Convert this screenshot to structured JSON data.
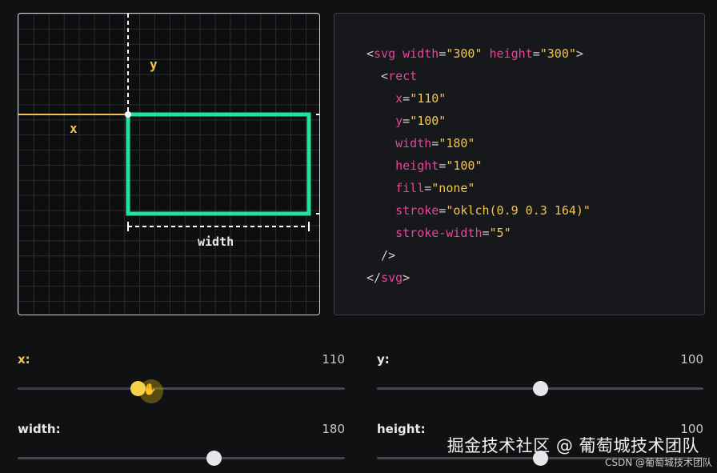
{
  "diagram": {
    "labels": {
      "x": "x",
      "y": "y",
      "width": "width"
    },
    "colors": {
      "rect_stroke": "#1ee59b",
      "x_line": "#f4c44a",
      "dash": "#ffffff"
    }
  },
  "code": {
    "lines": [
      {
        "parts": [
          [
            "punct",
            "<"
          ],
          [
            "tag",
            "svg "
          ],
          [
            "attr",
            "width"
          ],
          [
            "punct",
            "="
          ],
          [
            "val",
            "\"300\""
          ],
          [
            "punct",
            " "
          ],
          [
            "attr",
            "height"
          ],
          [
            "punct",
            "="
          ],
          [
            "val",
            "\"300\""
          ],
          [
            "punct",
            ">"
          ]
        ]
      },
      {
        "parts": [
          [
            "punct",
            "  <"
          ],
          [
            "tag",
            "rect"
          ]
        ]
      },
      {
        "parts": [
          [
            "punct",
            "    "
          ],
          [
            "attr",
            "x"
          ],
          [
            "punct",
            "="
          ],
          [
            "val",
            "\"110\""
          ]
        ]
      },
      {
        "parts": [
          [
            "punct",
            "    "
          ],
          [
            "attr",
            "y"
          ],
          [
            "punct",
            "="
          ],
          [
            "val",
            "\"100\""
          ]
        ]
      },
      {
        "parts": [
          [
            "punct",
            "    "
          ],
          [
            "attr",
            "width"
          ],
          [
            "punct",
            "="
          ],
          [
            "val",
            "\"180\""
          ]
        ]
      },
      {
        "parts": [
          [
            "punct",
            "    "
          ],
          [
            "attr",
            "height"
          ],
          [
            "punct",
            "="
          ],
          [
            "val",
            "\"100\""
          ]
        ]
      },
      {
        "parts": [
          [
            "punct",
            "    "
          ],
          [
            "attr",
            "fill"
          ],
          [
            "punct",
            "="
          ],
          [
            "val",
            "\"none\""
          ]
        ]
      },
      {
        "parts": [
          [
            "punct",
            "    "
          ],
          [
            "attr",
            "stroke"
          ],
          [
            "punct",
            "="
          ],
          [
            "val",
            "\"oklch(0.9 0.3 164)\""
          ]
        ]
      },
      {
        "parts": [
          [
            "punct",
            "    "
          ],
          [
            "attr",
            "stroke-width"
          ],
          [
            "punct",
            "="
          ],
          [
            "val",
            "\"5\""
          ]
        ]
      },
      {
        "parts": [
          [
            "punct",
            "  />"
          ]
        ]
      },
      {
        "parts": [
          [
            "punct",
            "</"
          ],
          [
            "tag",
            "svg"
          ],
          [
            "punct",
            ">"
          ]
        ]
      }
    ]
  },
  "controls": {
    "x": {
      "label": "x:",
      "value": "110",
      "fraction": 0.366
    },
    "y": {
      "label": "y:",
      "value": "100",
      "fraction": 0.5
    },
    "width": {
      "label": "width:",
      "value": "180",
      "fraction": 0.6
    },
    "height": {
      "label": "height:",
      "value": "100",
      "fraction": 0.5
    }
  },
  "watermark": {
    "main": "掘金技术社区 @ 葡萄城技术团队",
    "sub": "CSDN @葡萄城技术团队"
  }
}
